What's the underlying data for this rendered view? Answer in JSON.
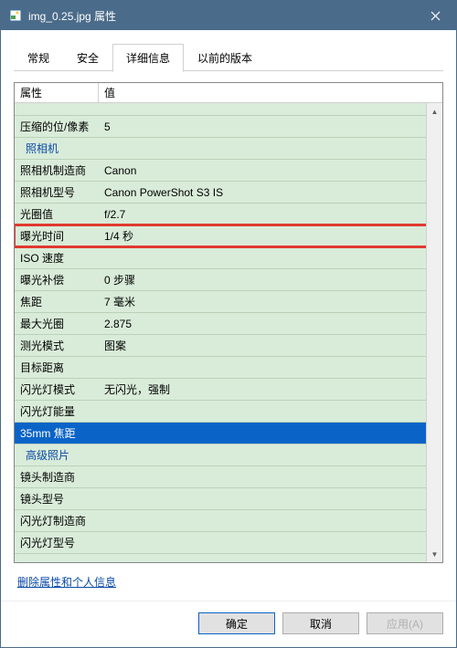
{
  "title": "img_0.25.jpg 属性",
  "tabs": {
    "general": "常规",
    "security": "安全",
    "details": "详细信息",
    "previous": "以前的版本"
  },
  "columns": {
    "attribute": "属性",
    "value": "值"
  },
  "cutRow": {
    "value": ""
  },
  "rows": {
    "bits": {
      "label": "压缩的位/像素",
      "value": "5"
    },
    "sectionCamera": "照相机",
    "maker": {
      "label": "照相机制造商",
      "value": "Canon"
    },
    "model": {
      "label": "照相机型号",
      "value": "Canon PowerShot S3 IS"
    },
    "fnum": {
      "label": "光圈值",
      "value": "f/2.7"
    },
    "exposure": {
      "label": "曝光时间",
      "value": "1/4 秒"
    },
    "iso": {
      "label": "ISO 速度",
      "value": ""
    },
    "ev": {
      "label": "曝光补偿",
      "value": "0 步骤"
    },
    "focal": {
      "label": "焦距",
      "value": "7 毫米"
    },
    "maxap": {
      "label": "最大光圈",
      "value": "2.875"
    },
    "meter": {
      "label": "测光模式",
      "value": "图案"
    },
    "subj": {
      "label": "目标距离",
      "value": ""
    },
    "flashm": {
      "label": "闪光灯模式",
      "value": "无闪光，强制"
    },
    "flashe": {
      "label": "闪光灯能量",
      "value": ""
    },
    "f35": {
      "label": "35mm 焦距",
      "value": ""
    },
    "sectionAdvanced": "高级照片",
    "lensmk": {
      "label": "镜头制造商",
      "value": ""
    },
    "lensmd": {
      "label": "镜头型号",
      "value": ""
    },
    "flmk": {
      "label": "闪光灯制造商",
      "value": ""
    },
    "flmd": {
      "label": "闪光灯型号",
      "value": ""
    }
  },
  "link": "删除属性和个人信息",
  "buttons": {
    "ok": "确定",
    "cancel": "取消",
    "apply": "应用(A)"
  }
}
